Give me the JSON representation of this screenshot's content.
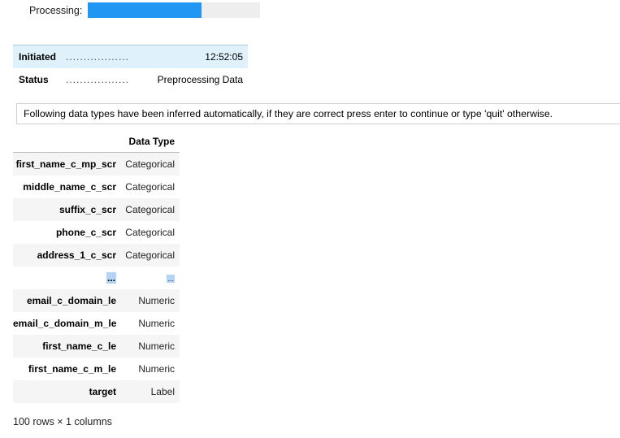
{
  "progress": {
    "label": "Processing:",
    "fraction": 0.66,
    "fill_color": "#2196f3"
  },
  "info": {
    "rows": [
      {
        "key": "Initiated",
        "dots": "..................",
        "value": "12:52:05"
      },
      {
        "key": "Status",
        "dots": "..................",
        "value": "Preprocessing Data"
      }
    ]
  },
  "message": "Following data types have been inferred automatically, if they are correct press enter to continue or type 'quit' otherwise.",
  "table": {
    "column_header": "Data Type",
    "rows": [
      {
        "name": "first_name_c_mp_scr",
        "type": "Categorical"
      },
      {
        "name": "middle_name_c_scr",
        "type": "Categorical"
      },
      {
        "name": "suffix_c_scr",
        "type": "Categorical"
      },
      {
        "name": "phone_c_scr",
        "type": "Categorical"
      },
      {
        "name": "address_1_c_scr",
        "type": "Categorical"
      },
      {
        "name": "...",
        "type": "..."
      },
      {
        "name": "email_c_domain_le",
        "type": "Numeric"
      },
      {
        "name": "email_c_domain_m_le",
        "type": "Numeric"
      },
      {
        "name": "first_name_c_le",
        "type": "Numeric"
      },
      {
        "name": "first_name_c_m_le",
        "type": "Numeric"
      },
      {
        "name": "target",
        "type": "Label"
      }
    ],
    "footer": "100 rows × 1 columns"
  }
}
